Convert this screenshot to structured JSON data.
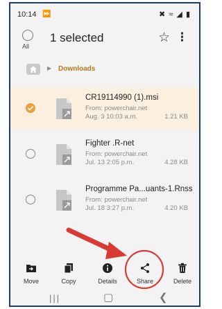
{
  "status_bar": {
    "time": "10:14",
    "download_icon": "download-notification-icon",
    "right_icons": [
      "mute-icon",
      "wifi-icon",
      "signal-icon",
      "battery-icon"
    ]
  },
  "selection_bar": {
    "all_label": "All",
    "title": "1 selected",
    "star_icon": "star-icon",
    "more_icon": "more-vert-icon"
  },
  "breadcrumb": {
    "home_icon": "home-icon",
    "path": "Downloads"
  },
  "files": [
    {
      "name": "CR19114990 (1).msi",
      "from": "From: powerchair.net",
      "date": "Aug. 3 10:03 a.m.",
      "size": "1.21 KB",
      "selected": true
    },
    {
      "name": "Fighter .R-net",
      "from": "From: powerchair.net",
      "date": "Jul. 13 2:05 p.m.",
      "size": "4.28 KB",
      "selected": false
    },
    {
      "name": "Programme Pa...uants-1.Rnss",
      "from": "From: powerchair.net",
      "date": "Jul. 18 3:27 p.m.",
      "size": "4.20 KB",
      "selected": false
    }
  ],
  "actions": [
    {
      "label": "Move",
      "icon": "move-icon"
    },
    {
      "label": "Copy",
      "icon": "copy-icon"
    },
    {
      "label": "Details",
      "icon": "info-icon"
    },
    {
      "label": "Share",
      "icon": "share-icon"
    },
    {
      "label": "Delete",
      "icon": "delete-icon"
    }
  ],
  "nav": {
    "recent_icon": "recents-icon",
    "home_icon": "home-nav-icon",
    "back_icon": "back-icon"
  },
  "colors": {
    "accent": "#e9a23b",
    "breadcrumb_text": "#b5781b",
    "highlight_red": "#d83a34",
    "selected_row": "#fbefdf"
  }
}
